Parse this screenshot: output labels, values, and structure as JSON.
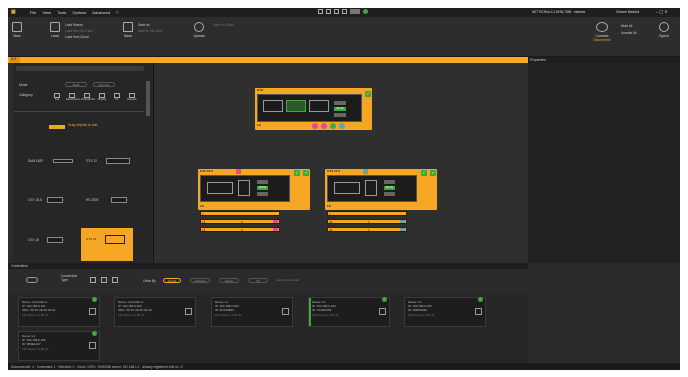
{
  "menu": [
    "File",
    "View",
    "Tools",
    "Options",
    "Advanced",
    "?"
  ],
  "window_user": "NET RCRed-4-1-BHN-7596 · network",
  "window_account": "Simone Bertolini",
  "ribbon": {
    "new": "New",
    "load": "Load",
    "load_items": [
      "Load Search",
      "Load from SD Card",
      "Load from Cloud"
    ],
    "save": "Save",
    "save_items": [
      "Save As",
      "Save to SD Card"
    ],
    "upload": "Upload",
    "upload_items": [
      "Save on Cloud"
    ],
    "connect": "Connect",
    "connect_sub": "Disconnect",
    "mute_all": "Mute All",
    "unmute_all": "Unmute All",
    "synch": "Synch"
  },
  "doc_tab": "S Z",
  "properties_title": "Properties",
  "left": {
    "mode_label": "Mode",
    "mode_options": [
      "Build",
      "Preview"
    ],
    "category_label": "Category",
    "categories": [
      "Full",
      "Rack/Stereo",
      "Vertical/Vert.",
      "Display",
      "Pc",
      "Discrete"
    ],
    "drag_hint": "Drag objects to add",
    "devices": [
      {
        "label": "DMA 162P"
      },
      {
        "label": "GTX 12"
      },
      {
        "label": "GTX 18.5"
      },
      {
        "label": "HS 2500"
      },
      {
        "label": "GTX 16"
      },
      {
        "label": "GTX 16"
      }
    ]
  },
  "canvas_devices": {
    "top": {
      "title": "GTX",
      "badge": "MUTE",
      "footer": "L8"
    },
    "left": {
      "title": "GTX 16 S",
      "badge": "MUTE",
      "rows": [
        "L8",
        "L",
        "L8",
        "L8"
      ],
      "row_vals": [
        "",
        "2",
        "",
        "2"
      ]
    },
    "right": {
      "title": "GTX 16 S",
      "badge": "MUTE",
      "rows": [
        "L8",
        "L",
        "L8",
        "L8"
      ],
      "row_vals": [
        "",
        "2",
        "",
        "2"
      ]
    }
  },
  "controllers": {
    "title": "Controllers",
    "connection_type": "Connection Type",
    "order_by": "Order By",
    "order_options": [
      "Model",
      "Address",
      "Name",
      "ID"
    ],
    "search_placeholder": "Search Controller",
    "cards": [
      {
        "name": "Name: Controller-1",
        "ip": "IP: 192.168.0.101",
        "mac": "MAC: 00:1C:2E:4F:0A:11",
        "fw": "FW Version 1.06.20"
      },
      {
        "name": "Name: Controller-2",
        "ip": "IP: 192.168.0.102",
        "mac": "MAC: 00:1C:2E:4F:0A:12",
        "fw": "FW Version 1.06.20"
      },
      {
        "name": "Name: L1",
        "ip": "IP: 192.168.0.103",
        "mac": "ID: 3F4C9B12",
        "fw": "FW Version 1.06.20"
      },
      {
        "name": "Name: L2",
        "ip": "IP: 192.168.0.104",
        "mac": "ID: 7A1D0C55",
        "fw": "FW Version 1.06.20"
      },
      {
        "name": "Name: L3",
        "ip": "IP: 192.168.0.105",
        "mac": "ID: 2E8F6A90",
        "fw": "FW Version 1.06.20"
      },
      {
        "name": "Name: L4",
        "ip": "IP: 192.168.0.106",
        "mac": "ID: 9B3E1F07",
        "fw": "FW Version 1.06.20"
      }
    ]
  },
  "status": "Disconnected: 4 · Connected: 1 · Selected: 0 · Zoom: 100% · DNS/SNI server: 192.168.1.1 · already registered with id = 0",
  "colors": {
    "accent": "#f5a623",
    "ok": "#3fa83f"
  }
}
